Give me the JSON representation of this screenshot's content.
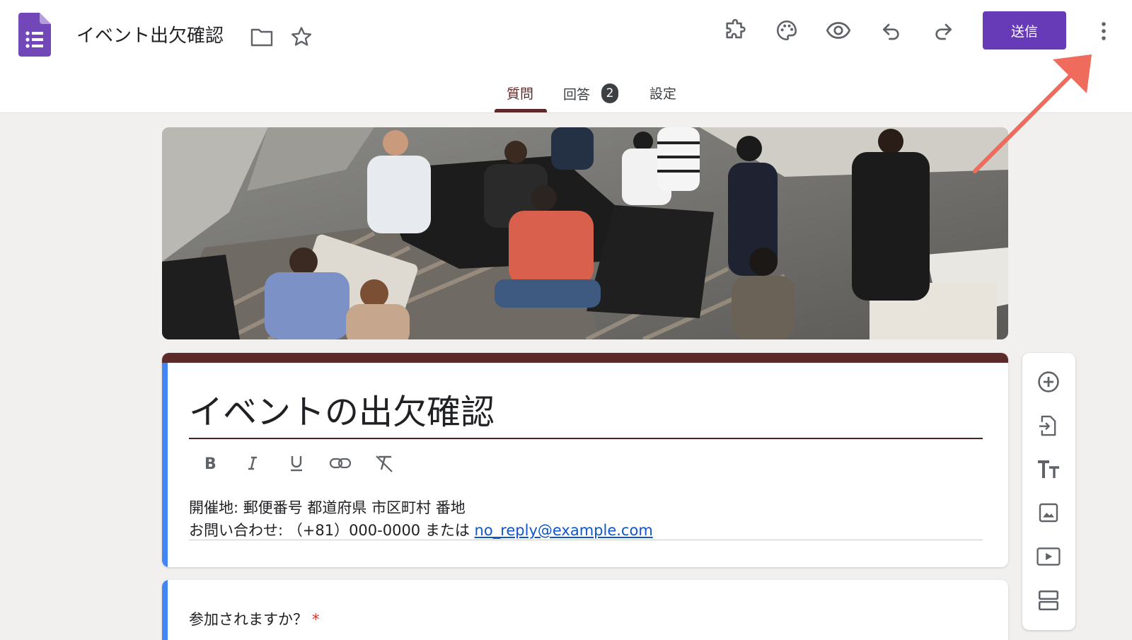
{
  "header": {
    "doc_title": "イベント出欠確認",
    "send_label": "送信"
  },
  "tabs": [
    {
      "label": "質問",
      "active": true
    },
    {
      "label": "回答",
      "badge": "2"
    },
    {
      "label": "設定"
    }
  ],
  "form": {
    "title": "イベントの出欠確認",
    "description_line1": "開催地: 郵便番号 都道府県 市区町村 番地",
    "description_line2_prefix": "お問い合わせ: （+81）000-0000 または ",
    "description_email": "no_reply@example.com"
  },
  "question": {
    "text": "参加されますか？",
    "required_mark": "*"
  },
  "icons": {
    "header": [
      "folder-icon",
      "star-icon",
      "addon-puzzle-icon",
      "palette-icon",
      "preview-eye-icon",
      "undo-icon",
      "redo-icon",
      "more-vert-icon"
    ],
    "format": [
      "bold-icon",
      "italic-icon",
      "underline-icon",
      "link-icon",
      "clear-format-icon"
    ],
    "side_toolbar": [
      "add-question-icon",
      "import-questions-icon",
      "add-title-icon",
      "add-image-icon",
      "add-video-icon",
      "add-section-icon"
    ]
  },
  "colors": {
    "accent": "#673ab7",
    "theme": "#5d2a2a",
    "left_accent": "#4285f4",
    "annotation_arrow": "#ef6b5b"
  }
}
